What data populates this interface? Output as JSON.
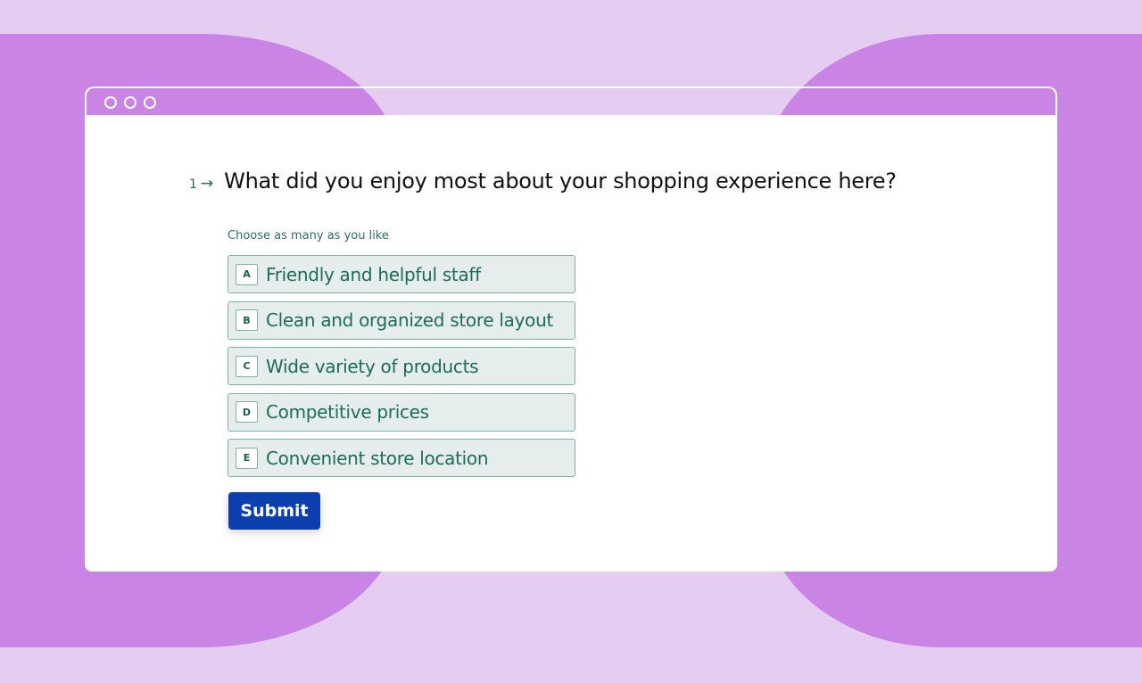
{
  "colors": {
    "background": "#e5cdf2",
    "blob": "#c984e6",
    "accent": "#1e6b5c",
    "option_bg": "#e5eeec",
    "option_border": "#7fb2a6",
    "submit_bg": "#0b3fae"
  },
  "window": {
    "controls": [
      "circle",
      "circle",
      "circle"
    ]
  },
  "question": {
    "number": "1",
    "arrow": "→",
    "text": "What did you enjoy most about your shopping experience here?",
    "hint": "Choose as many as you like"
  },
  "options": [
    {
      "key": "A",
      "label": "Friendly and helpful staff"
    },
    {
      "key": "B",
      "label": "Clean and organized store layout"
    },
    {
      "key": "C",
      "label": "Wide variety of products"
    },
    {
      "key": "D",
      "label": "Competitive prices"
    },
    {
      "key": "E",
      "label": "Convenient store location"
    }
  ],
  "submit_label": "Submit"
}
